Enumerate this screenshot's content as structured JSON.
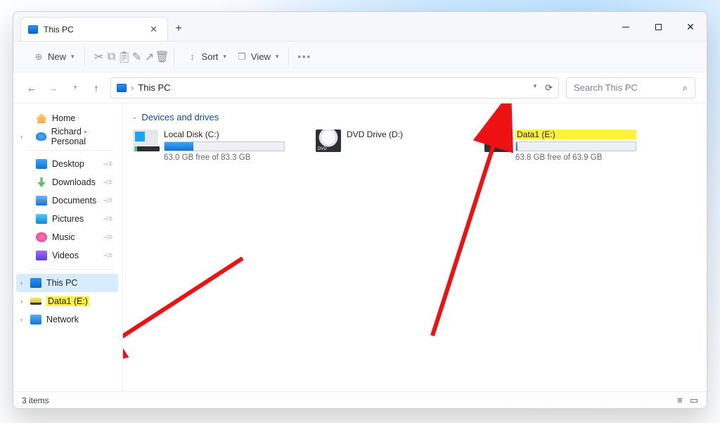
{
  "window": {
    "title": "This PC"
  },
  "toolbar": {
    "new": "New",
    "sort": "Sort",
    "view": "View"
  },
  "address": {
    "path": "This PC",
    "search_placeholder": "Search This PC"
  },
  "sidebar": {
    "home": "Home",
    "personal": "Richard - Personal",
    "quick": [
      {
        "label": "Desktop"
      },
      {
        "label": "Downloads"
      },
      {
        "label": "Documents"
      },
      {
        "label": "Pictures"
      },
      {
        "label": "Music"
      },
      {
        "label": "Videos"
      }
    ],
    "tree": [
      {
        "label": "This PC",
        "selected": true
      },
      {
        "label": "Data1 (E:)",
        "highlight": true
      },
      {
        "label": "Network"
      }
    ]
  },
  "content": {
    "section": "Devices and drives",
    "drives": [
      {
        "name": "Local Disk (C:)",
        "free": "63.0 GB free of 83.3 GB",
        "fill_pct": 24,
        "icon": "win",
        "highlight": false
      },
      {
        "name": "DVD Drive (D:)",
        "free": "",
        "fill_pct": null,
        "icon": "dvd",
        "highlight": false
      },
      {
        "name": "Data1 (E:)",
        "free": "63.8 GB free of 63.9 GB",
        "fill_pct": 1,
        "icon": "dat",
        "highlight": true
      }
    ]
  },
  "status": {
    "count": "3 items"
  }
}
